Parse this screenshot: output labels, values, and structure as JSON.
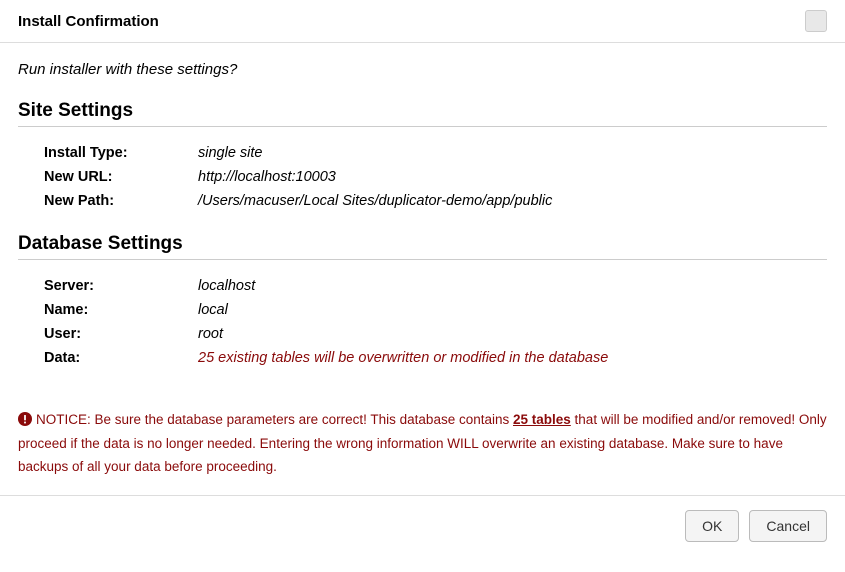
{
  "header": {
    "title": "Install Confirmation"
  },
  "prompt": "Run installer with these settings?",
  "site_settings": {
    "heading": "Site Settings",
    "rows": {
      "install_type": {
        "label": "Install Type:",
        "value": "single site"
      },
      "new_url": {
        "label": "New URL:",
        "value": "http://localhost:10003"
      },
      "new_path": {
        "label": "New Path:",
        "value": "/Users/macuser/Local Sites/duplicator-demo/app/public"
      }
    }
  },
  "db_settings": {
    "heading": "Database Settings",
    "rows": {
      "server": {
        "label": "Server:",
        "value": "localhost"
      },
      "name": {
        "label": "Name:",
        "value": "local"
      },
      "user": {
        "label": "User:",
        "value": "root"
      },
      "data": {
        "label": "Data:",
        "value": "25 existing tables will be overwritten or modified in the database"
      }
    }
  },
  "notice": {
    "prefix": "NOTICE: Be sure the database parameters are correct! This database contains ",
    "link": "25 tables",
    "suffix": " that will be modified and/or removed! Only proceed if the data is no longer needed. Entering the wrong information WILL overwrite an existing database. Make sure to have backups of all your data before proceeding."
  },
  "buttons": {
    "ok": "OK",
    "cancel": "Cancel"
  }
}
